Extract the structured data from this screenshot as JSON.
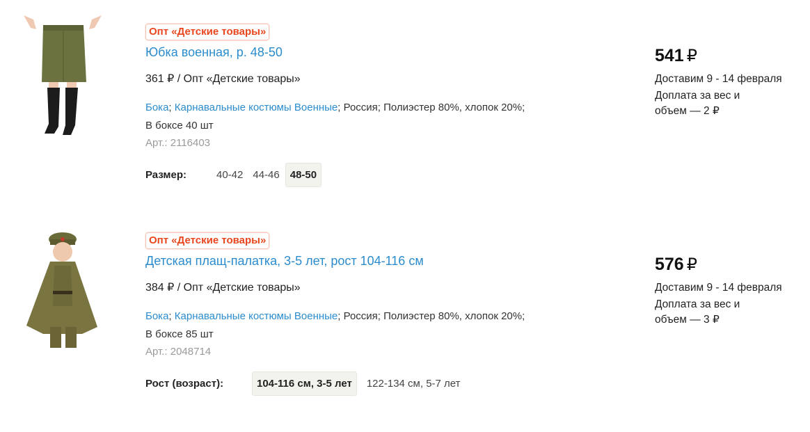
{
  "products": [
    {
      "badge": "Опт «Детские товары»",
      "title": "Юбка военная, р. 48-50",
      "wholesale_price": "361",
      "currency": "₽",
      "wholesale_suffix": " / Опт «Детские товары»",
      "link1": "Бока",
      "sep": "; ",
      "link2": "Карнавальные костюмы Военные",
      "meta_rest": "; Россия; Полиэстер 80%, хлопок 20%;",
      "box": "В боксе 40 шт",
      "sku": "Арт.: 2116403",
      "variant_label": "Размер:",
      "options": [
        "40-42",
        "44-46",
        "48-50"
      ],
      "selected_option": "48-50",
      "price": "541",
      "delivery": "Доставим 9 - 14 февраля",
      "surcharge": "Доплата за вес и объем — 2",
      "image": "skirt-photo"
    },
    {
      "badge": "Опт «Детские товары»",
      "title": "Детская плащ-палатка, 3-5 лет, рост 104-116 см",
      "wholesale_price": "384",
      "currency": "₽",
      "wholesale_suffix": " / Опт «Детские товары»",
      "link1": "Бока",
      "sep": "; ",
      "link2": "Карнавальные костюмы Военные",
      "meta_rest": "; Россия; Полиэстер 80%, хлопок 20%;",
      "box": "В боксе 85 шт",
      "sku": "Арт.: 2048714",
      "variant_label": "Рост (возраст):",
      "options": [
        "104-116 см, 3-5 лет",
        "122-134 см, 5-7 лет"
      ],
      "selected_option": "104-116 см, 3-5 лет",
      "price": "576",
      "delivery": "Доставим 9 - 14 февраля",
      "surcharge": "Доплата за вес и объем — 3",
      "image": "cape-photo"
    }
  ],
  "colors": {
    "accent_link": "#2b8ccd",
    "badge": "#e8461e",
    "muted": "#9a9a9a"
  }
}
